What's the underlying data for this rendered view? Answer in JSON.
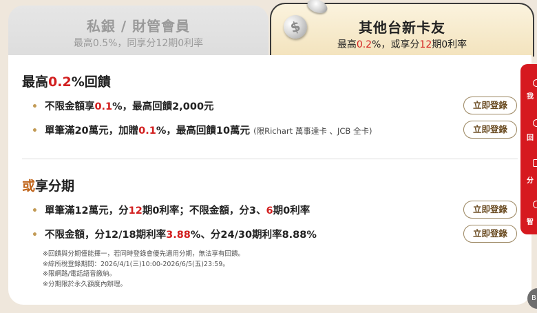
{
  "tabs": {
    "left": {
      "title": "私銀 / 財管會員",
      "subtitle": "最高0.5%，同享分12期0利率"
    },
    "right": {
      "title": "其他台新卡友",
      "subtitle_pre": "最高",
      "subtitle_rate": "0.2",
      "subtitle_mid": "%，或享分",
      "subtitle_num": "12",
      "subtitle_post": "期0利率"
    }
  },
  "section1": {
    "title_pre": "最高",
    "title_rate": "0.2",
    "title_post": "%回饋",
    "items": [
      {
        "pre": "不限金額享",
        "rate": "0.1",
        "post": "%，最高回饋2,000元",
        "note": ""
      },
      {
        "pre": "單筆滿20萬元，加贈",
        "rate": "0.1",
        "post": "%，最高回饋10萬元",
        "note": "(限Richart 萬事達卡 、JCB 全卡)"
      }
    ]
  },
  "section2": {
    "title_a": "或",
    "title_b": "享分期",
    "items": [
      {
        "p1": "單筆滿12萬元，分",
        "r1": "12",
        "p2": "期0利率；不限金額，分3、",
        "r2": "6",
        "p3": "期0利率"
      },
      {
        "p1": "不限金額，分12/18期利率",
        "r1": "3.88",
        "p2": "%、分24/30期利率8.88%",
        "r2": "",
        "p3": ""
      }
    ]
  },
  "button_label": "立即登錄",
  "notes": [
    "※回饋與分期僅能擇一，若同時登錄會優先適用分期，無法享有回饋。",
    "※綜所稅登錄期間：2026/4/1(三)10:00-2026/6/5(五)23:59。",
    "※限網路/電話語音繳納。",
    "※分期限於永久額度內辦理。"
  ],
  "sidebar": {
    "items": [
      "我",
      "回",
      "分",
      "智"
    ]
  },
  "fab_label": "B",
  "colors": {
    "accent_red": "#d21f1f",
    "gold": "#c29a55",
    "orange": "#c0651b"
  }
}
